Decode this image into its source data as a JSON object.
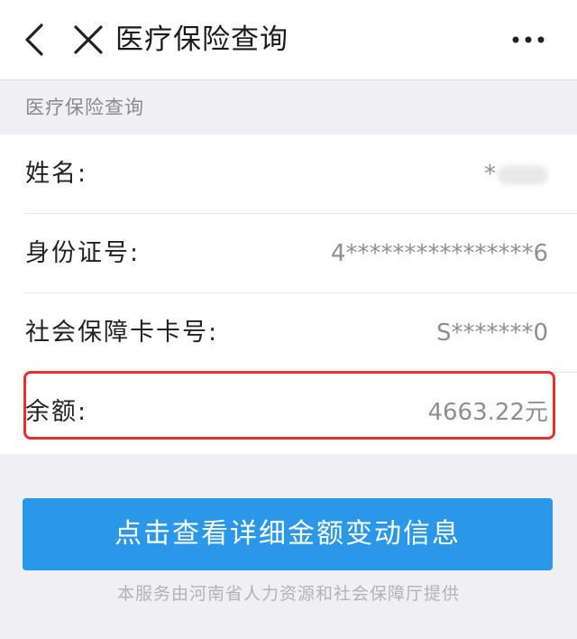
{
  "topbar": {
    "title": "医疗保险查询",
    "icons": {
      "back": "chevron-left-icon",
      "close": "close-icon",
      "more": "more-icon"
    }
  },
  "section": {
    "title": "医疗保险查询"
  },
  "rows": [
    {
      "label": "姓名:",
      "value": "*"
    },
    {
      "label": "身份证号:",
      "value": "4****************6"
    },
    {
      "label": "社会保障卡卡号:",
      "value": "S*******0"
    },
    {
      "label": "余额:",
      "value": "4663.22元"
    }
  ],
  "actions": {
    "details_button": "点击查看详细金额变动信息"
  },
  "footer": {
    "note": "本服务由河南省人力资源和社会保障厅提供"
  },
  "colors": {
    "primary_button": "#2a97e8",
    "highlight_border": "#e53030",
    "background": "#efeff4"
  }
}
